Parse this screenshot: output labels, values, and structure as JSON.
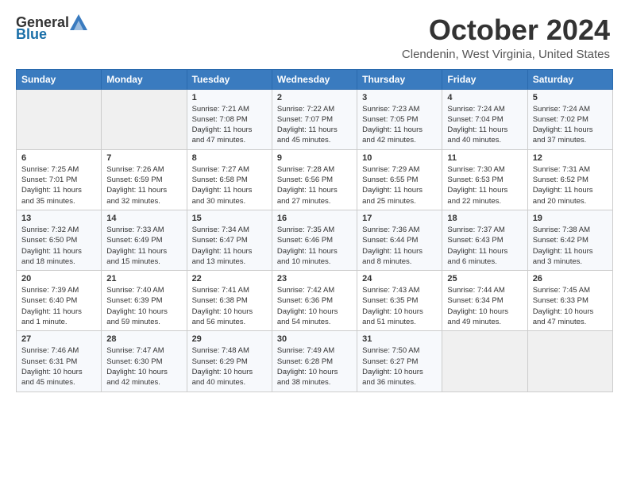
{
  "header": {
    "logo_general": "General",
    "logo_blue": "Blue",
    "month": "October 2024",
    "location": "Clendenin, West Virginia, United States"
  },
  "weekdays": [
    "Sunday",
    "Monday",
    "Tuesday",
    "Wednesday",
    "Thursday",
    "Friday",
    "Saturday"
  ],
  "weeks": [
    [
      {
        "day": "",
        "sunrise": "",
        "sunset": "",
        "daylight": ""
      },
      {
        "day": "",
        "sunrise": "",
        "sunset": "",
        "daylight": ""
      },
      {
        "day": "1",
        "sunrise": "Sunrise: 7:21 AM",
        "sunset": "Sunset: 7:08 PM",
        "daylight": "Daylight: 11 hours and 47 minutes."
      },
      {
        "day": "2",
        "sunrise": "Sunrise: 7:22 AM",
        "sunset": "Sunset: 7:07 PM",
        "daylight": "Daylight: 11 hours and 45 minutes."
      },
      {
        "day": "3",
        "sunrise": "Sunrise: 7:23 AM",
        "sunset": "Sunset: 7:05 PM",
        "daylight": "Daylight: 11 hours and 42 minutes."
      },
      {
        "day": "4",
        "sunrise": "Sunrise: 7:24 AM",
        "sunset": "Sunset: 7:04 PM",
        "daylight": "Daylight: 11 hours and 40 minutes."
      },
      {
        "day": "5",
        "sunrise": "Sunrise: 7:24 AM",
        "sunset": "Sunset: 7:02 PM",
        "daylight": "Daylight: 11 hours and 37 minutes."
      }
    ],
    [
      {
        "day": "6",
        "sunrise": "Sunrise: 7:25 AM",
        "sunset": "Sunset: 7:01 PM",
        "daylight": "Daylight: 11 hours and 35 minutes."
      },
      {
        "day": "7",
        "sunrise": "Sunrise: 7:26 AM",
        "sunset": "Sunset: 6:59 PM",
        "daylight": "Daylight: 11 hours and 32 minutes."
      },
      {
        "day": "8",
        "sunrise": "Sunrise: 7:27 AM",
        "sunset": "Sunset: 6:58 PM",
        "daylight": "Daylight: 11 hours and 30 minutes."
      },
      {
        "day": "9",
        "sunrise": "Sunrise: 7:28 AM",
        "sunset": "Sunset: 6:56 PM",
        "daylight": "Daylight: 11 hours and 27 minutes."
      },
      {
        "day": "10",
        "sunrise": "Sunrise: 7:29 AM",
        "sunset": "Sunset: 6:55 PM",
        "daylight": "Daylight: 11 hours and 25 minutes."
      },
      {
        "day": "11",
        "sunrise": "Sunrise: 7:30 AM",
        "sunset": "Sunset: 6:53 PM",
        "daylight": "Daylight: 11 hours and 22 minutes."
      },
      {
        "day": "12",
        "sunrise": "Sunrise: 7:31 AM",
        "sunset": "Sunset: 6:52 PM",
        "daylight": "Daylight: 11 hours and 20 minutes."
      }
    ],
    [
      {
        "day": "13",
        "sunrise": "Sunrise: 7:32 AM",
        "sunset": "Sunset: 6:50 PM",
        "daylight": "Daylight: 11 hours and 18 minutes."
      },
      {
        "day": "14",
        "sunrise": "Sunrise: 7:33 AM",
        "sunset": "Sunset: 6:49 PM",
        "daylight": "Daylight: 11 hours and 15 minutes."
      },
      {
        "day": "15",
        "sunrise": "Sunrise: 7:34 AM",
        "sunset": "Sunset: 6:47 PM",
        "daylight": "Daylight: 11 hours and 13 minutes."
      },
      {
        "day": "16",
        "sunrise": "Sunrise: 7:35 AM",
        "sunset": "Sunset: 6:46 PM",
        "daylight": "Daylight: 11 hours and 10 minutes."
      },
      {
        "day": "17",
        "sunrise": "Sunrise: 7:36 AM",
        "sunset": "Sunset: 6:44 PM",
        "daylight": "Daylight: 11 hours and 8 minutes."
      },
      {
        "day": "18",
        "sunrise": "Sunrise: 7:37 AM",
        "sunset": "Sunset: 6:43 PM",
        "daylight": "Daylight: 11 hours and 6 minutes."
      },
      {
        "day": "19",
        "sunrise": "Sunrise: 7:38 AM",
        "sunset": "Sunset: 6:42 PM",
        "daylight": "Daylight: 11 hours and 3 minutes."
      }
    ],
    [
      {
        "day": "20",
        "sunrise": "Sunrise: 7:39 AM",
        "sunset": "Sunset: 6:40 PM",
        "daylight": "Daylight: 11 hours and 1 minute."
      },
      {
        "day": "21",
        "sunrise": "Sunrise: 7:40 AM",
        "sunset": "Sunset: 6:39 PM",
        "daylight": "Daylight: 10 hours and 59 minutes."
      },
      {
        "day": "22",
        "sunrise": "Sunrise: 7:41 AM",
        "sunset": "Sunset: 6:38 PM",
        "daylight": "Daylight: 10 hours and 56 minutes."
      },
      {
        "day": "23",
        "sunrise": "Sunrise: 7:42 AM",
        "sunset": "Sunset: 6:36 PM",
        "daylight": "Daylight: 10 hours and 54 minutes."
      },
      {
        "day": "24",
        "sunrise": "Sunrise: 7:43 AM",
        "sunset": "Sunset: 6:35 PM",
        "daylight": "Daylight: 10 hours and 51 minutes."
      },
      {
        "day": "25",
        "sunrise": "Sunrise: 7:44 AM",
        "sunset": "Sunset: 6:34 PM",
        "daylight": "Daylight: 10 hours and 49 minutes."
      },
      {
        "day": "26",
        "sunrise": "Sunrise: 7:45 AM",
        "sunset": "Sunset: 6:33 PM",
        "daylight": "Daylight: 10 hours and 47 minutes."
      }
    ],
    [
      {
        "day": "27",
        "sunrise": "Sunrise: 7:46 AM",
        "sunset": "Sunset: 6:31 PM",
        "daylight": "Daylight: 10 hours and 45 minutes."
      },
      {
        "day": "28",
        "sunrise": "Sunrise: 7:47 AM",
        "sunset": "Sunset: 6:30 PM",
        "daylight": "Daylight: 10 hours and 42 minutes."
      },
      {
        "day": "29",
        "sunrise": "Sunrise: 7:48 AM",
        "sunset": "Sunset: 6:29 PM",
        "daylight": "Daylight: 10 hours and 40 minutes."
      },
      {
        "day": "30",
        "sunrise": "Sunrise: 7:49 AM",
        "sunset": "Sunset: 6:28 PM",
        "daylight": "Daylight: 10 hours and 38 minutes."
      },
      {
        "day": "31",
        "sunrise": "Sunrise: 7:50 AM",
        "sunset": "Sunset: 6:27 PM",
        "daylight": "Daylight: 10 hours and 36 minutes."
      },
      {
        "day": "",
        "sunrise": "",
        "sunset": "",
        "daylight": ""
      },
      {
        "day": "",
        "sunrise": "",
        "sunset": "",
        "daylight": ""
      }
    ]
  ]
}
